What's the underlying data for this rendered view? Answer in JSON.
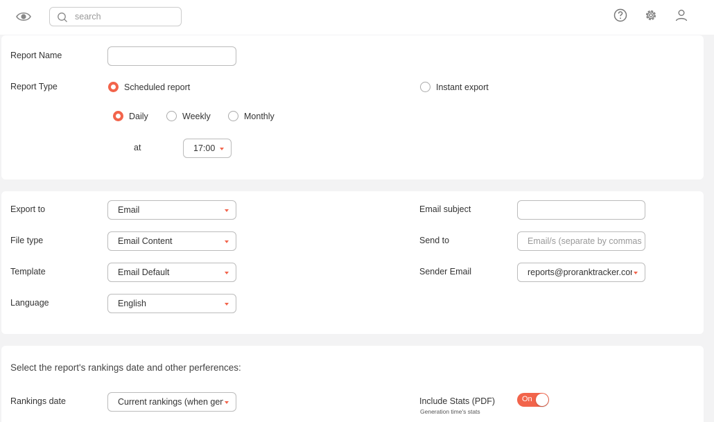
{
  "colors": {
    "accent": "#f2644b",
    "background": "#f3f3f4",
    "card": "#ffffff"
  },
  "topbar": {
    "search_placeholder": "search",
    "icons": [
      "eye-icon",
      "search-icon",
      "help-icon",
      "gear-icon",
      "user-icon"
    ]
  },
  "report": {
    "name_label": "Report Name",
    "name_value": "",
    "type_label": "Report Type",
    "type_options": [
      "Scheduled report",
      "Instant export"
    ],
    "type_selected": "Scheduled report",
    "frequency_options": [
      "Daily",
      "Weekly",
      "Monthly"
    ],
    "frequency_selected": "Daily",
    "at_label": "at",
    "time_value": "17:00"
  },
  "export": {
    "export_to_label": "Export to",
    "export_to_value": "Email",
    "file_type_label": "File type",
    "file_type_value": "Email Content",
    "template_label": "Template",
    "template_value": "Email Default",
    "language_label": "Language",
    "language_value": "English",
    "email_subject_label": "Email subject",
    "email_subject_value": "",
    "send_to_label": "Send to",
    "send_to_placeholder": "Email/s (separate by commas)",
    "sender_email_label": "Sender Email",
    "sender_email_value": "reports@proranktracker.com"
  },
  "preferences": {
    "heading": "Select the report's rankings date and other perferences:",
    "rankings_date_label": "Rankings date",
    "rankings_date_value": "Current rankings (when generated)",
    "include_stats_label": "Include Stats (PDF)",
    "include_stats_note": "Generation time's stats",
    "include_stats_toggle_text": "On",
    "include_stats_on": true
  }
}
